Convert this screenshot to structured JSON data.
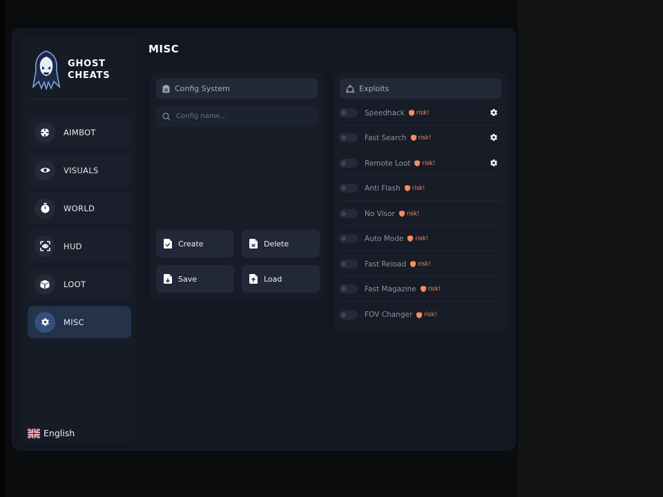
{
  "brand": {
    "line1": "GHOST",
    "line2": "CHEATS"
  },
  "page_title": "MISC",
  "sidebar": {
    "items": [
      {
        "label": "AIMBOT",
        "icon": "crosshair-icon"
      },
      {
        "label": "VISUALS",
        "icon": "eye-icon"
      },
      {
        "label": "WORLD",
        "icon": "stopwatch-icon"
      },
      {
        "label": "HUD",
        "icon": "scan-eye-icon"
      },
      {
        "label": "LOOT",
        "icon": "box-icon"
      },
      {
        "label": "MISC",
        "icon": "gear-icon",
        "active": true
      }
    ],
    "language": "English"
  },
  "config": {
    "header": "Config System",
    "input_placeholder": "Config name...",
    "input_value": "",
    "buttons": {
      "create": "Create",
      "delete": "Delete",
      "save": "Save",
      "load": "Load"
    }
  },
  "exploits": {
    "header": "Exploits",
    "risk_label": "risk!",
    "items": [
      {
        "label": "Speedhack",
        "enabled": false,
        "has_settings": true
      },
      {
        "label": "Fast Search",
        "enabled": false,
        "has_settings": true
      },
      {
        "label": "Remote Loot",
        "enabled": false,
        "has_settings": true
      },
      {
        "label": "Anti Flash",
        "enabled": false,
        "has_settings": false
      },
      {
        "label": "No Visor",
        "enabled": false,
        "has_settings": false
      },
      {
        "label": "Auto Mode",
        "enabled": false,
        "has_settings": false
      },
      {
        "label": "Fast Reload",
        "enabled": false,
        "has_settings": false
      },
      {
        "label": "Fast Magazine",
        "enabled": false,
        "has_settings": false
      },
      {
        "label": "FOV Changer",
        "enabled": false,
        "has_settings": false
      }
    ]
  },
  "colors": {
    "accent": "#35507a",
    "risk": "#f58d5c",
    "panel": "#131722"
  }
}
